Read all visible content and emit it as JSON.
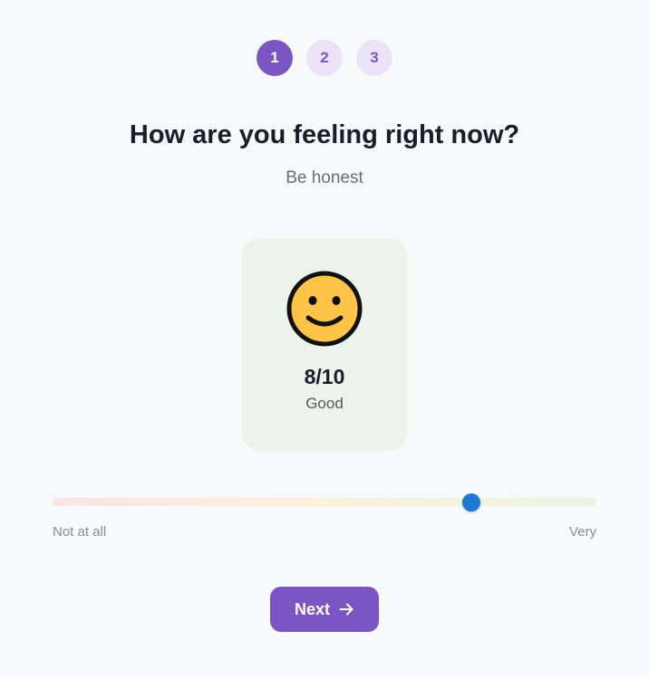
{
  "stepper": {
    "steps": [
      {
        "label": "1",
        "state": "active"
      },
      {
        "label": "2",
        "state": "inactive"
      },
      {
        "label": "3",
        "state": "inactive"
      }
    ],
    "current_step": 1
  },
  "question": {
    "title": "How are you feeling right now?",
    "subtitle": "Be honest"
  },
  "mood_card": {
    "icon": "smiling-face-icon",
    "score": "8/10",
    "label": "Good"
  },
  "slider": {
    "min_label": "Not at all",
    "max_label": "Very",
    "value_fraction": 0.77
  },
  "actions": {
    "next_label": "Next",
    "next_icon": "arrow-right-icon"
  },
  "colors": {
    "accent": "#7b55c1",
    "accent_light": "#ebe4f8",
    "card_bg": "#ebf4e9",
    "slider_thumb": "#1f78d1",
    "emoji_fill": "#fec447",
    "background": "#f8f9fb"
  }
}
